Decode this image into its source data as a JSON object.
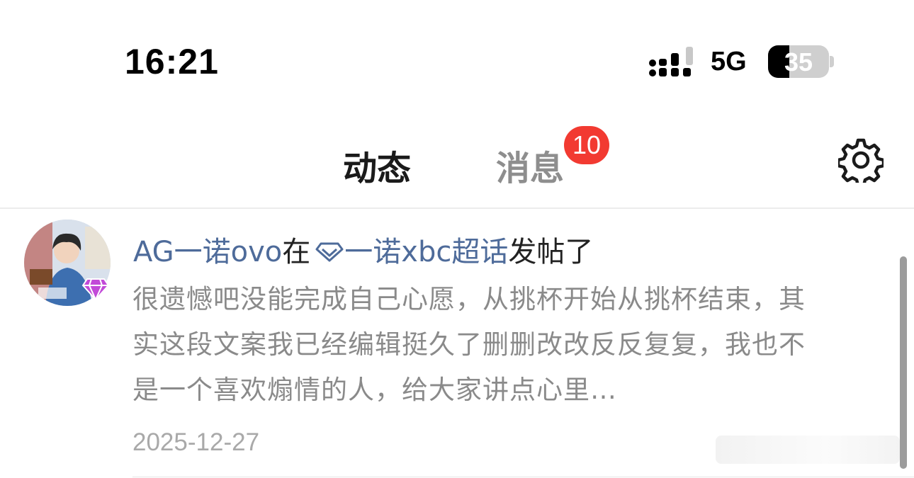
{
  "status_bar": {
    "time": "16:21",
    "network": "5G",
    "battery": "35",
    "battery_level": 0.35
  },
  "tabs": [
    {
      "label": "动态",
      "active": true
    },
    {
      "label": "消息",
      "active": false,
      "badge": "10"
    }
  ],
  "settings_icon": "gear-icon",
  "post": {
    "author": "AG一诺ovo",
    "preposition": "在",
    "topic_icon": "diamond-icon",
    "topic": "一诺xbc超话",
    "action": "发帖了",
    "content": "很遗憾吧没能完成自己心愿，从挑杯开始从挑杯结束，其实这段文案我已经编辑挺久了删删改改反反复复，我也不是一个喜欢煽情的人，给大家讲点心里…",
    "date": "2025-12-27"
  },
  "colors": {
    "accent": "#ff9f00",
    "badge": "#f23a31",
    "link": "#4e6b9a",
    "muted_text": "#8a8a8a"
  }
}
